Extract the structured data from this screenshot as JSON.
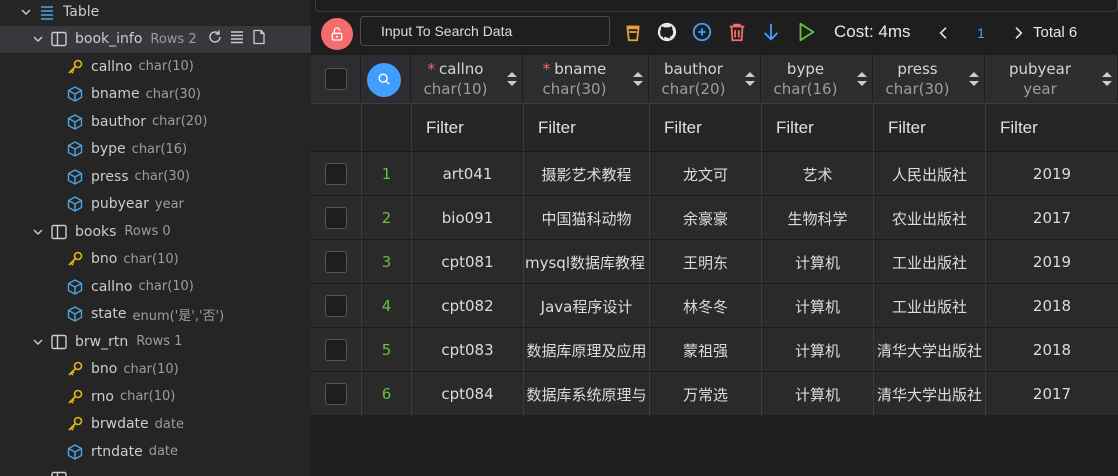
{
  "sidebar": {
    "root": {
      "label": "Table"
    },
    "tables": [
      {
        "name": "book_info",
        "rows": "Rows 2",
        "selected": true,
        "columns": [
          {
            "name": "callno",
            "type": "char(10)",
            "key": true
          },
          {
            "name": "bname",
            "type": "char(30)",
            "key": false
          },
          {
            "name": "bauthor",
            "type": "char(20)",
            "key": false
          },
          {
            "name": "bype",
            "type": "char(16)",
            "key": false
          },
          {
            "name": "press",
            "type": "char(30)",
            "key": false
          },
          {
            "name": "pubyear",
            "type": "year",
            "key": false
          }
        ]
      },
      {
        "name": "books",
        "rows": "Rows 0",
        "selected": false,
        "columns": [
          {
            "name": "bno",
            "type": "char(10)",
            "key": true
          },
          {
            "name": "callno",
            "type": "char(10)",
            "key": false
          },
          {
            "name": "state",
            "type": "enum('是','否')",
            "key": false
          }
        ]
      },
      {
        "name": "brw_rtn",
        "rows": "Rows 1",
        "selected": false,
        "columns": [
          {
            "name": "bno",
            "type": "char(10)",
            "key": true
          },
          {
            "name": "rno",
            "type": "char(10)",
            "key": true
          },
          {
            "name": "brwdate",
            "type": "date",
            "key": true
          },
          {
            "name": "rtndate",
            "type": "date",
            "key": false
          }
        ]
      }
    ]
  },
  "toolbar": {
    "search_placeholder": "Input To Search Data",
    "cost": "Cost: 4ms",
    "page": "1",
    "total": "Total 6"
  },
  "grid": {
    "filter_label": "Filter",
    "columns": [
      {
        "name": "callno",
        "type": "char(10)",
        "required": true
      },
      {
        "name": "bname",
        "type": "char(30)",
        "required": true
      },
      {
        "name": "bauthor",
        "type": "char(20)",
        "required": false
      },
      {
        "name": "bype",
        "type": "char(16)",
        "required": false
      },
      {
        "name": "press",
        "type": "char(30)",
        "required": false
      },
      {
        "name": "pubyear",
        "type": "year",
        "required": false
      }
    ],
    "rows": [
      {
        "n": "1",
        "cells": [
          "art041",
          "摄影艺术教程",
          "龙文可",
          "艺术",
          "人民出版社",
          "2019"
        ]
      },
      {
        "n": "2",
        "cells": [
          "bio091",
          "中国猫科动物",
          "余豪豪",
          "生物科学",
          "农业出版社",
          "2017"
        ]
      },
      {
        "n": "3",
        "cells": [
          "cpt081",
          "mysql数据库教程",
          "王明东",
          "计算机",
          "工业出版社",
          "2019"
        ]
      },
      {
        "n": "4",
        "cells": [
          "cpt082",
          "Java程序设计",
          "林冬冬",
          "计算机",
          "工业出版社",
          "2018"
        ]
      },
      {
        "n": "5",
        "cells": [
          "cpt083",
          "数据库原理及应用",
          "蒙祖强",
          "计算机",
          "清华大学出版社",
          "2018"
        ]
      },
      {
        "n": "6",
        "cells": [
          "cpt084",
          "数据库系统原理与",
          "万常选",
          "计算机",
          "清华大学出版社",
          "2017"
        ]
      }
    ]
  },
  "colors": {
    "accent": "#409eff",
    "danger": "#f56c6c",
    "success": "#67c23a",
    "key_icon": "#e2b714",
    "column_icon": "#4fa3e0",
    "github": "#e8e8e8",
    "export": "#e2a03f"
  }
}
